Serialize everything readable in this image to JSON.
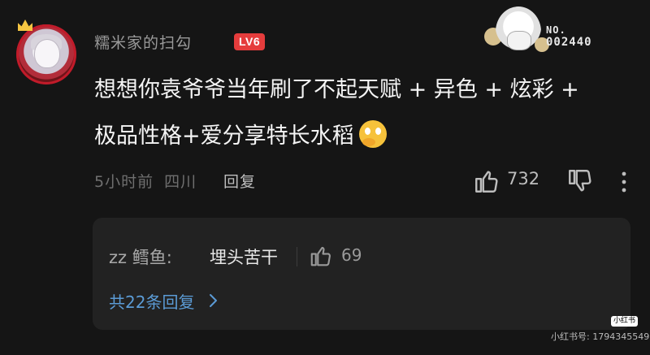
{
  "comment": {
    "username": "糯米家的扫勾",
    "level": "LV6",
    "text_line1": "想想你袁爷爷当年刷了不起天赋 + 异色 + 炫彩 +",
    "text_line2": "极品性格+爱分享特长水稻",
    "time": "5小时前",
    "location": "四川",
    "reply_label": "回复",
    "likes": "732"
  },
  "decoration": {
    "no_label": "NO.",
    "no_number": "002440"
  },
  "reply": {
    "username": "zz 鳕鱼:",
    "text": "埋头苦干",
    "likes": "69",
    "view_all": "共22条回复"
  },
  "watermark": {
    "logo": "小红书",
    "id_text": "小红书号: 1794345549"
  },
  "colors": {
    "background": "#151515",
    "level_badge": "#e53c3c",
    "link_blue": "#5b9bd5",
    "reply_box": "#222222"
  }
}
